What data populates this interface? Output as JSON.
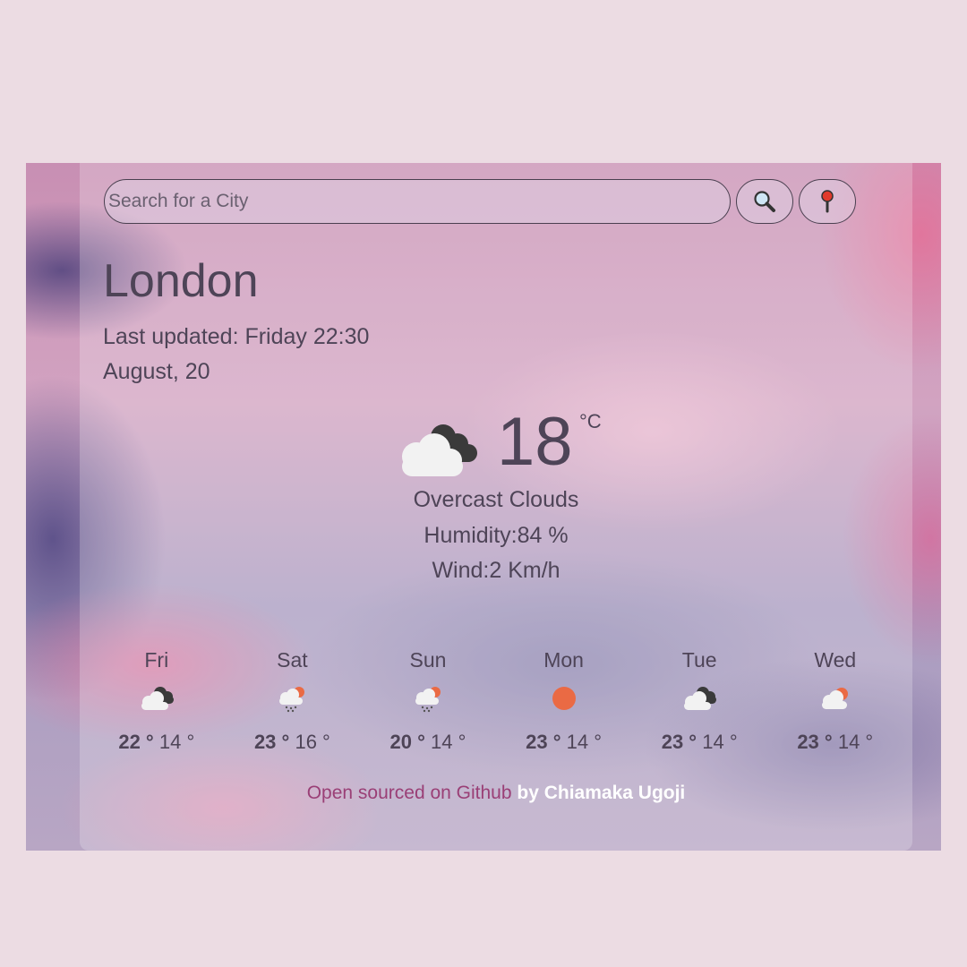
{
  "search": {
    "placeholder": "Search for a City"
  },
  "buttons": {
    "search_icon": "search-icon",
    "location_icon": "location-pin-icon"
  },
  "current": {
    "city": "London",
    "last_updated": "Last updated: Friday 22:30",
    "date": "August, 20",
    "icon": "overcast-clouds-icon",
    "temperature": "18",
    "unit": "°C",
    "description": "Overcast Clouds",
    "humidity": "Humidity:84 %",
    "wind": "Wind:2 Km/h"
  },
  "forecast": [
    {
      "day": "Fri",
      "icon": "broken-clouds-icon",
      "max": "22 °",
      "min": "14 °"
    },
    {
      "day": "Sat",
      "icon": "rain-icon",
      "max": "23 °",
      "min": "16 °"
    },
    {
      "day": "Sun",
      "icon": "rain-icon",
      "max": "20 °",
      "min": "14 °"
    },
    {
      "day": "Mon",
      "icon": "sun-icon",
      "max": "23 °",
      "min": "14 °"
    },
    {
      "day": "Tue",
      "icon": "broken-clouds-icon",
      "max": "23 °",
      "min": "14 °"
    },
    {
      "day": "Wed",
      "icon": "partly-cloudy-icon",
      "max": "23 °",
      "min": "14 °"
    }
  ],
  "footer": {
    "link_text": "Open sourced on Github",
    "author_text": " by Chiamaka Ugoji"
  },
  "colors": {
    "text": "#4e4457",
    "link": "#9a3f76",
    "sun": "#ea6a44"
  }
}
